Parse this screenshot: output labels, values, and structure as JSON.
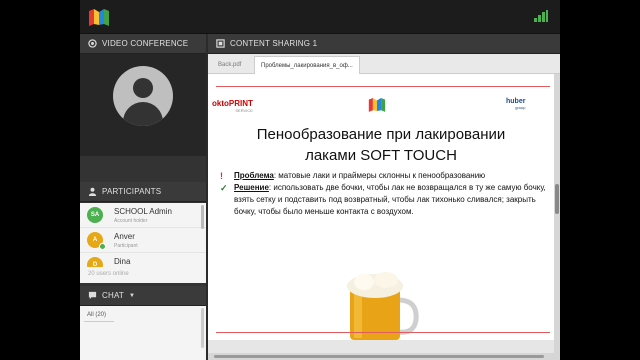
{
  "video": {
    "header": "VIDEO CONFERENCE"
  },
  "content": {
    "header": "CONTENT SHARING 1",
    "tabs": [
      {
        "label": "Back.pdf"
      },
      {
        "label": "Проблемы_лакирования_в_оф..."
      }
    ]
  },
  "participants": {
    "header": "PARTICIPANTS",
    "items": [
      {
        "initials": "SA",
        "name": "SCHOOL Admin",
        "role": "Account holder",
        "color": "#4caf50"
      },
      {
        "initials": "A",
        "name": "Anver",
        "role": "Participant",
        "color": "#e6a817"
      },
      {
        "initials": "D",
        "name": "Dina",
        "role": "",
        "color": "#e6a817"
      }
    ],
    "online": "20 users online"
  },
  "chat": {
    "header": "CHAT",
    "tab": "All (20)"
  },
  "slide": {
    "brand_left": "oktoPRINT",
    "brand_left_sub": "SERVICE",
    "brand_right": "huber",
    "brand_right_sub": "group",
    "title_line1": "Пенообразование при лакировании",
    "title_line2": "лаками SOFT TOUCH",
    "bullets": [
      {
        "mark": "!",
        "mark_color": "#d32f2f",
        "term": "Проблема",
        "text": ": матовые лаки и праймеры склонны к пенообразованию"
      },
      {
        "mark": "✓",
        "mark_color": "#2e7d32",
        "term": "Решение",
        "text": ": использовать две бочки, чтобы лак не возвращался в ту же самую бочку, взять сетку и подставить под возвратный, чтобы лак тихонько сливался; закрыть бочку, чтобы было меньше контакта с воздухом."
      }
    ]
  },
  "colors": {
    "accent": "#4caf50",
    "warning": "#e6a817",
    "slide_rule": "#e05b5b"
  }
}
